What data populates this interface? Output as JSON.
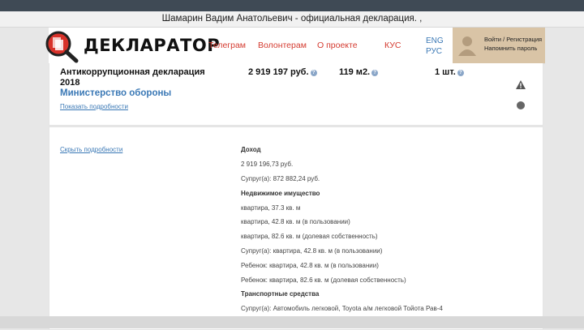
{
  "page_title": "Шамарин Вадим Анатольевич - официальная декларация. ,",
  "logo": {
    "text": "ДЕКЛАРАТОР"
  },
  "nav": [
    {
      "label": "Телеграм"
    },
    {
      "label": "Волонтерам"
    },
    {
      "label": "О проекте"
    },
    {
      "label": "КУС"
    }
  ],
  "lang": {
    "eng": "ENG",
    "rus": "РУС"
  },
  "login": {
    "line1": "Войти / Регистрация",
    "line2": "Напомнить пароль"
  },
  "declaration": {
    "title": "Антикоррупционная декларация 2018",
    "ministry": "Министерство обороны",
    "show_details": "Показать подробности",
    "income": "2 919 197 руб.",
    "area": "119 м2.",
    "vehicles": "1 шт."
  },
  "details": {
    "hide_details": "Скрыть подробности",
    "income_heading": "Доход",
    "income_value": "2 919 196,73 руб.",
    "spouse_income": "Супруг(а): 872 882,24 руб.",
    "realty_heading": "Недвижимое имущество",
    "realty": [
      "квартира, 37.3 кв. м",
      "квартира, 42.8 кв. м (в пользовании)",
      "квартира, 82.6 кв. м (долевая собственность)",
      "Супруг(а): квартира, 42.8 кв. м (в пользовании)",
      "Ребенок: квартира, 42.8 кв. м (в пользовании)",
      "Ребенок: квартира, 82.6 кв. м (долевая собственность)"
    ],
    "transport_heading": "Транспортные средства",
    "transport": [
      "Супруг(а): Автомобиль легковой, Toyota а/м легковой Тойота Рав-4"
    ]
  },
  "colors": {
    "accent_red": "#d43a2f",
    "link_blue": "#3a78b5",
    "login_bg": "#d9c4a6"
  },
  "icons": {
    "help": "question-circle-icon",
    "warning": "warning-triangle-icon",
    "status": "status-dot-icon"
  }
}
